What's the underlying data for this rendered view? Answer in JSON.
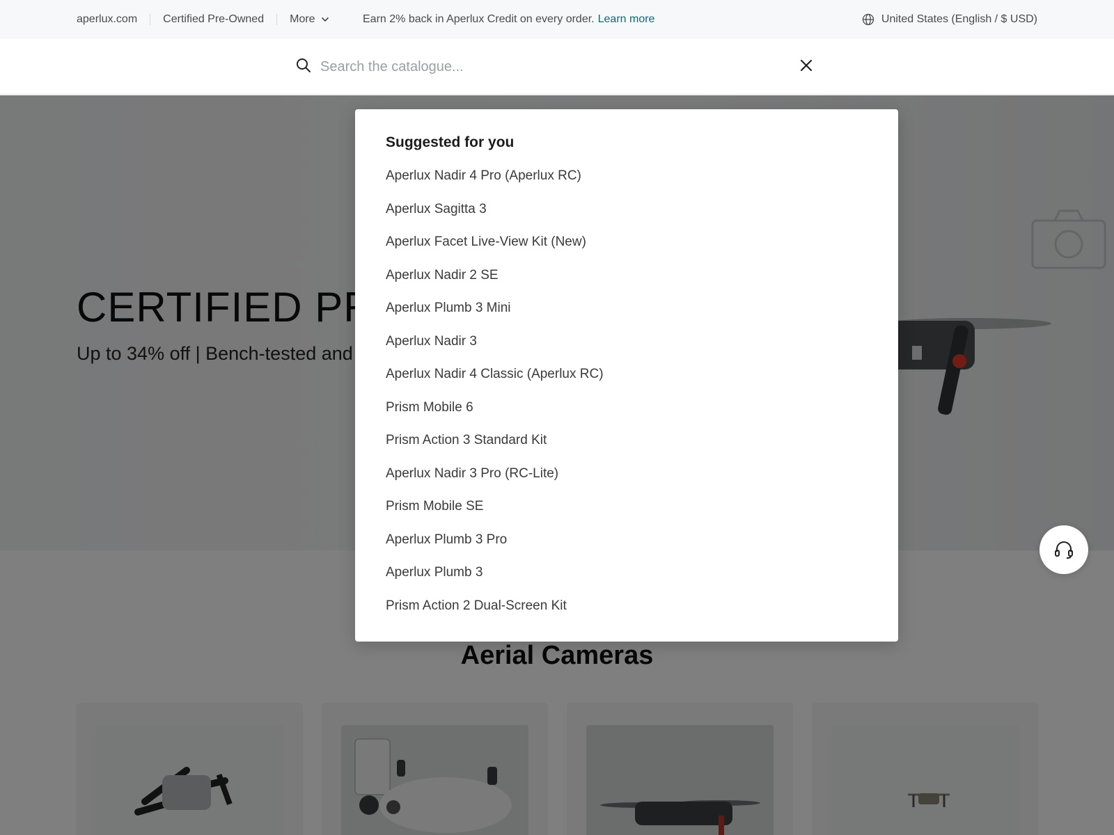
{
  "topbar": {
    "site": "aperlux.com",
    "certified": "Certified Pre-Owned",
    "more": "More",
    "promo_text": "Earn 2% back in Aperlux Credit on every order.",
    "promo_link": "Learn more",
    "region": "United States (English / $ USD)",
    "icons": {
      "more": "chevron-down-icon",
      "region": "globe-icon"
    }
  },
  "search": {
    "placeholder": "Search the catalogue...",
    "value": "",
    "icons": {
      "search": "search-icon",
      "close": "close-icon"
    }
  },
  "hero": {
    "title": "CERTIFIED PRE",
    "subtitle": "Up to 34% off | Bench-tested and"
  },
  "section": {
    "title": "Aerial Cameras"
  },
  "suggestions": {
    "heading": "Suggested for you",
    "items": [
      "Aperlux Nadir 4 Pro (Aperlux RC)",
      "Aperlux Sagitta 3",
      "Aperlux Facet Live-View Kit (New)",
      "Aperlux Nadir 2 SE",
      "Aperlux Plumb 3 Mini",
      "Aperlux Nadir 3",
      "Aperlux Nadir 4 Classic (Aperlux RC)",
      "Prism Mobile 6",
      "Prism Action 3 Standard Kit",
      "Aperlux Nadir 3 Pro (RC-Lite)",
      "Prism Mobile SE",
      "Aperlux Plumb 3 Pro",
      "Aperlux Plumb 3",
      "Prism Action 2 Dual-Screen Kit"
    ]
  },
  "support": {
    "icon": "headset-icon"
  },
  "colors": {
    "link": "#0b6b74",
    "overlay": "rgba(0,0,0,0.5)",
    "topbar_bg": "#f7f8f9"
  }
}
